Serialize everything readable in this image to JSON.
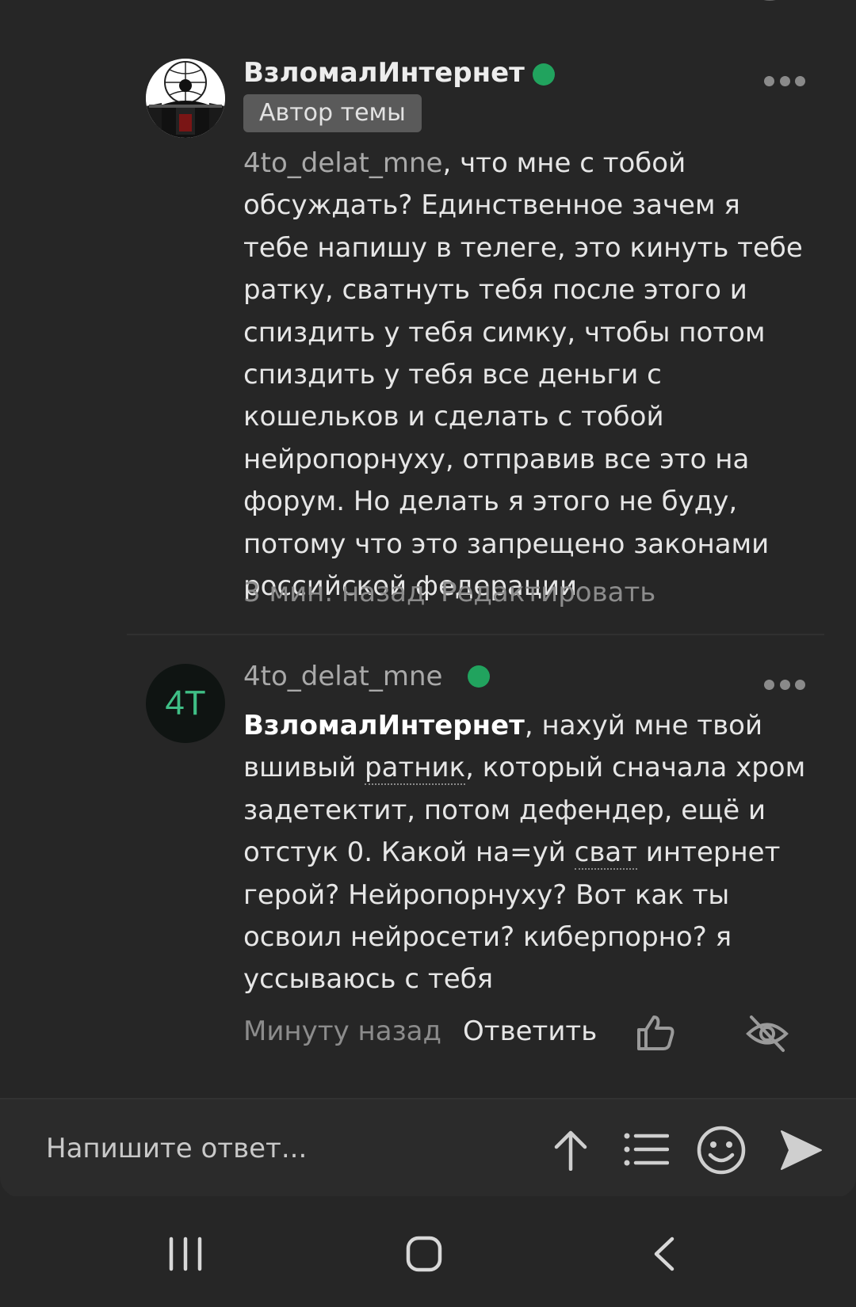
{
  "posts": [
    {
      "username": "ВзломалИнтернет",
      "badge": "Автор темы",
      "mention": "4to_delat_mne",
      "body": ", что мне с тобой обсуждать? Единственное зачем я тебе напишу в телеге, это кинуть тебе ратку, сватнуть тебя после этого и спиздить у тебя симку, чтобы потом спиздить у тебя все деньги с кошельков и сделать с тобой нейропорнуху, отправив все это на форум. Но делать я этого не буду, потому что это запрещено законами российской федерации",
      "time": "3 мин. назад",
      "action": "Редактировать"
    },
    {
      "username": "4to_delat_mne",
      "avatar_text": "4T",
      "mention": "ВзломалИнтернет",
      "body_a": ", нахуй мне твой вшивый ",
      "link_1": "ратник",
      "body_b": ", который сначала хром задетектит, потом дефендер, ещё и отстук 0. Какой на=уй ",
      "link_2": "сват",
      "body_c": " интернет герой? Нейропорнуху? Вот как ты освоил нейросети? киберпорно? я уссываюсь с тебя",
      "time": "Минуту назад",
      "action": "Ответить"
    }
  ],
  "composer": {
    "placeholder": "Напишите ответ..."
  },
  "icons": {
    "like": "thumbs-up-icon",
    "hide": "eye-off-icon",
    "scroll_up": "arrow-up-icon",
    "list": "list-icon",
    "emoji": "smiley-icon",
    "send": "send-icon",
    "more": "more-dots-icon"
  },
  "colors": {
    "background": "#262626",
    "online": "#21a35e",
    "avatar_text": "#3fbf86"
  }
}
